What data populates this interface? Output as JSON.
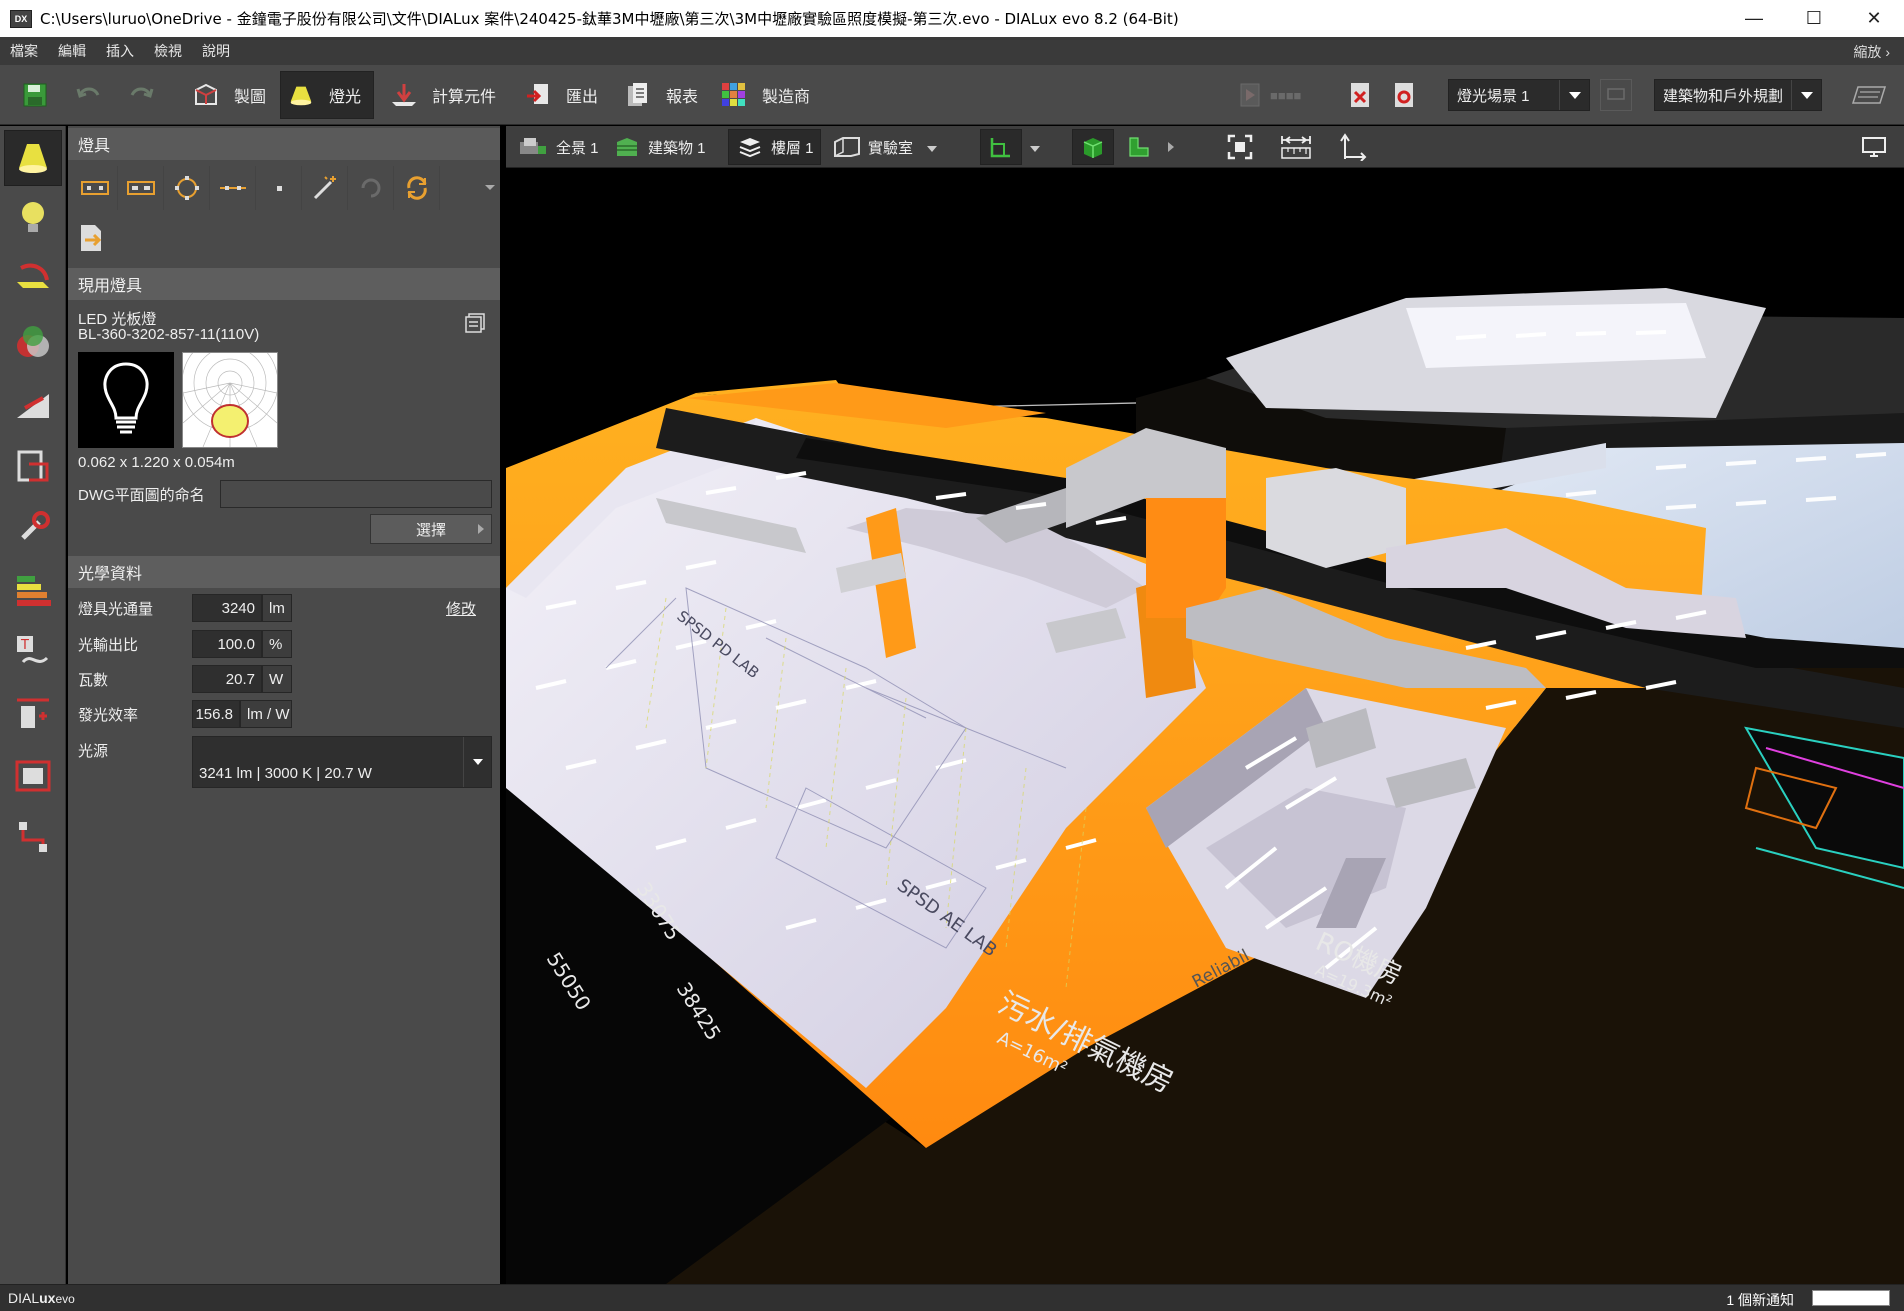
{
  "window": {
    "title": "C:\\Users\\luruo\\OneDrive - 金鐘電子股份有限公司\\文件\\DIALux 案件\\240425-鈦華3M中壢廠\\第三次\\3M中壢廠實驗區照度模擬-第三次.evo - DIALux evo 8.2  (64-Bit)",
    "app_icon": "DX"
  },
  "menu": {
    "items": [
      "檔案",
      "編輯",
      "插入",
      "檢視",
      "說明"
    ],
    "zoom": "縮放"
  },
  "toolbar": {
    "modes": [
      {
        "label": "製圖",
        "icon": "construction-icon"
      },
      {
        "label": "燈光",
        "icon": "light-icon"
      },
      {
        "label": "計算元件",
        "icon": "calculation-icon"
      },
      {
        "label": "匯出",
        "icon": "export-icon"
      },
      {
        "label": "報表",
        "icon": "report-icon"
      },
      {
        "label": "製造商",
        "icon": "manufacturer-icon"
      }
    ],
    "light_scene": "燈光場景 1",
    "planning": "建築物和戶外規劃"
  },
  "view_toolbar": {
    "items": [
      {
        "label": "全景 1"
      },
      {
        "label": "建築物 1"
      },
      {
        "label": "樓層 1"
      },
      {
        "label": "實驗室"
      }
    ]
  },
  "panel": {
    "header": "燈具",
    "current_section": "現用燈具",
    "luminaire_name": "LED 光板燈",
    "luminaire_model": "BL-360-3202-857-11(110V)",
    "dimensions": "0.062 x 1.220 x 0.054m",
    "dwg_label": "DWG平面圖的命名",
    "dwg_value": "",
    "select_button": "選擇",
    "optics_section": "光學資料",
    "optics": [
      {
        "label": "燈具光通量",
        "value": "3240",
        "unit": "lm"
      },
      {
        "label": "光輸出比",
        "value": "100.0",
        "unit": "%"
      },
      {
        "label": "瓦數",
        "value": "20.7",
        "unit": "W"
      },
      {
        "label": "發光效率",
        "value": "156.8",
        "unit": "lm / W"
      }
    ],
    "modify_link": "修改",
    "source_label": "光源",
    "source_value": "3241 lm  |  3000 K  |  20.7 W"
  },
  "viewport": {
    "labels": {
      "lab1": "SPSD PD LAB",
      "lab2": "SPSD AE LAB",
      "room_ro": "RO機房",
      "room_ro_area": "A=19.3m²",
      "room_waste": "污水/排氣機房",
      "room_waste_area": "A=16m²",
      "dim1": "33075",
      "dim2": "55050",
      "dim3": "38425",
      "reliab": "Reliabil"
    }
  },
  "status": {
    "brand_prefix": "DIAL",
    "brand_bold": "ux",
    "brand_suffix": "evo",
    "notification": "1 個新通知"
  }
}
